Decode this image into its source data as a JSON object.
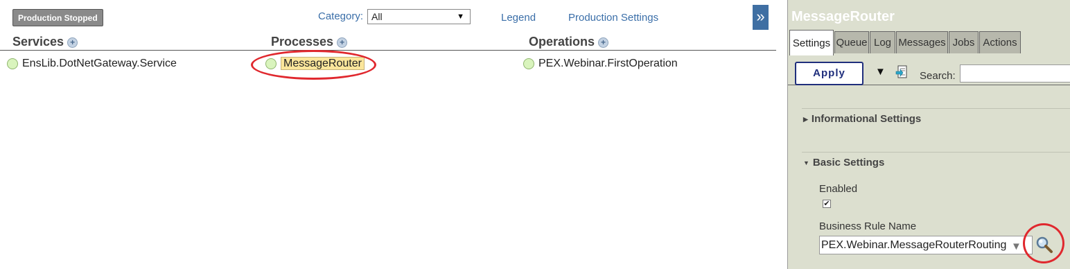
{
  "production": {
    "status": "Production Stopped",
    "category_label": "Category:",
    "category_value": "All",
    "links": {
      "legend": "Legend",
      "settings": "Production Settings"
    },
    "expand_glyph": "»",
    "columns": {
      "services": {
        "header": "Services",
        "items": [
          "EnsLib.DotNetGateway.Service"
        ]
      },
      "processes": {
        "header": "Processes",
        "items": [
          "MessageRouter"
        ]
      },
      "operations": {
        "header": "Operations",
        "items": [
          "PEX.Webinar.FirstOperation"
        ]
      }
    },
    "colors": {
      "status_ok_dot": "#d9f4bd",
      "selected_item_bg": "#fbe69b",
      "annotation_red": "#e0282e",
      "link_blue": "#3a6ea8"
    }
  },
  "panel": {
    "title": "MessageRouter",
    "tabs": [
      "Settings",
      "Queue",
      "Log",
      "Messages",
      "Jobs",
      "Actions"
    ],
    "active_tab": "Settings",
    "apply_label": "Apply",
    "search_label": "Search:",
    "sections": {
      "informational": "Informational Settings",
      "basic": "Basic Settings"
    },
    "enabled_label": "Enabled",
    "enabled_checked": true,
    "rule_label": "Business Rule Name",
    "rule_value": "PEX.Webinar.MessageRouterRouting",
    "icons": [
      "funnel-icon",
      "export-icon",
      "magnifier-icon",
      "checkmark-icon",
      "chevron-down-icon"
    ]
  }
}
